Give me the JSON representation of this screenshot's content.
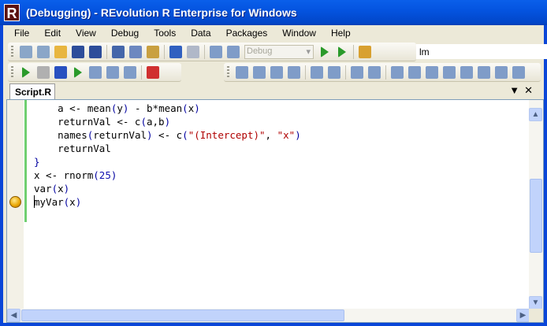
{
  "window": {
    "title": "(Debugging) - REvolution R Enterprise for Windows",
    "logo": "R"
  },
  "menu": [
    "File",
    "Edit",
    "View",
    "Debug",
    "Tools",
    "Data",
    "Packages",
    "Window",
    "Help"
  ],
  "toolbar1": {
    "icons": [
      "new-project-icon",
      "new-file-icon",
      "open-folder-icon",
      "save-icon",
      "save-all-icon",
      "sep",
      "cut-icon",
      "copy-icon",
      "paste-icon",
      "sep",
      "undo-icon",
      "redo-icon",
      "sep",
      "navigate-icon",
      "navigate-forward-icon"
    ],
    "config": "Debug",
    "after": [
      "start-icon",
      "step-run-icon",
      "sep",
      "find-icon"
    ],
    "search_value": "lm"
  },
  "toolbar2": {
    "icons": [
      "run-icon",
      "pause-icon",
      "stop-icon",
      "restart-icon",
      "step-into-icon",
      "step-over-icon",
      "step-out-icon",
      "sep",
      "breakpoint-icon"
    ]
  },
  "toolbar3": {
    "icons": [
      "list-members-icon",
      "parameter-info-icon",
      "quick-info-icon",
      "complete-word-icon",
      "sep",
      "outdent-icon",
      "indent-icon",
      "sep",
      "comment-icon",
      "uncomment-icon",
      "sep",
      "toggle-bookmark-icon",
      "prev-bookmark-icon",
      "next-bookmark-icon",
      "prev-bookmark-folder-icon",
      "next-bookmark-folder-icon",
      "prev-bookmark-file-icon",
      "next-bookmark-file-icon",
      "clear-bookmarks-icon"
    ]
  },
  "tabs": {
    "active": "Script.R",
    "menu_glyph": "▼",
    "close_glyph": "✕"
  },
  "code": [
    [
      [
        "    a <- mean",
        ""
      ],
      [
        "(",
        "p"
      ],
      [
        "y",
        ""
      ],
      [
        ")",
        "p"
      ],
      [
        " - b*mean",
        ""
      ],
      [
        "(",
        "p"
      ],
      [
        "x",
        ""
      ],
      [
        ")",
        "p"
      ]
    ],
    [
      [
        "    returnVal <- c",
        ""
      ],
      [
        "(",
        "p"
      ],
      [
        "a,b",
        ""
      ],
      [
        ")",
        "p"
      ]
    ],
    [
      [
        "    names",
        ""
      ],
      [
        "(",
        "p"
      ],
      [
        "returnVal",
        ""
      ],
      [
        ")",
        "p"
      ],
      [
        " <- c",
        ""
      ],
      [
        "(",
        "p"
      ],
      [
        "\"(Intercept)\"",
        "s"
      ],
      [
        ", ",
        ""
      ],
      [
        "\"x\"",
        "s"
      ],
      [
        ")",
        "p"
      ]
    ],
    [
      [
        "    returnVal",
        ""
      ]
    ],
    [
      [
        "}",
        "p"
      ]
    ],
    [
      [
        "x <- rnorm",
        ""
      ],
      [
        "(",
        "p"
      ],
      [
        "25",
        "n"
      ],
      [
        ")",
        "p"
      ]
    ],
    [
      [
        "var",
        ""
      ],
      [
        "(",
        "p"
      ],
      [
        "x",
        ""
      ],
      [
        ")",
        "p"
      ]
    ],
    [
      [
        "myVar",
        ""
      ],
      [
        "(",
        "p"
      ],
      [
        "x",
        ""
      ],
      [
        ")",
        "p"
      ]
    ]
  ],
  "colors": {
    "titlebar": "#0454E0",
    "green_margin": "#70CF70",
    "string": "#B00000",
    "number": "#1010B0"
  }
}
